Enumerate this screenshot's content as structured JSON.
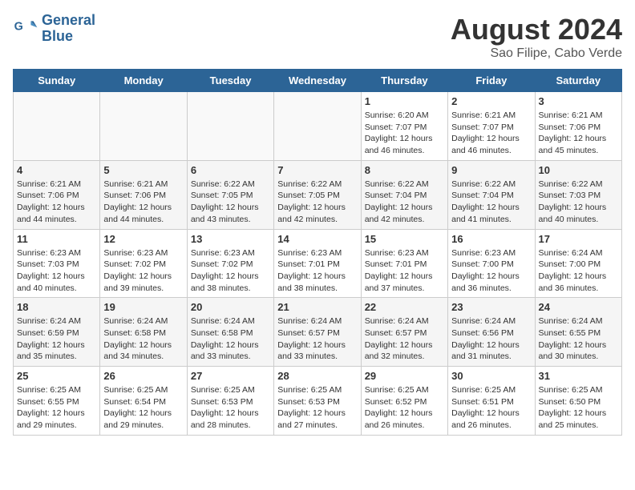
{
  "header": {
    "logo_line1": "General",
    "logo_line2": "Blue",
    "month_year": "August 2024",
    "location": "Sao Filipe, Cabo Verde"
  },
  "days_of_week": [
    "Sunday",
    "Monday",
    "Tuesday",
    "Wednesday",
    "Thursday",
    "Friday",
    "Saturday"
  ],
  "weeks": [
    [
      {
        "day": "",
        "info": ""
      },
      {
        "day": "",
        "info": ""
      },
      {
        "day": "",
        "info": ""
      },
      {
        "day": "",
        "info": ""
      },
      {
        "day": "1",
        "info": "Sunrise: 6:20 AM\nSunset: 7:07 PM\nDaylight: 12 hours\nand 46 minutes."
      },
      {
        "day": "2",
        "info": "Sunrise: 6:21 AM\nSunset: 7:07 PM\nDaylight: 12 hours\nand 46 minutes."
      },
      {
        "day": "3",
        "info": "Sunrise: 6:21 AM\nSunset: 7:06 PM\nDaylight: 12 hours\nand 45 minutes."
      }
    ],
    [
      {
        "day": "4",
        "info": "Sunrise: 6:21 AM\nSunset: 7:06 PM\nDaylight: 12 hours\nand 44 minutes."
      },
      {
        "day": "5",
        "info": "Sunrise: 6:21 AM\nSunset: 7:06 PM\nDaylight: 12 hours\nand 44 minutes."
      },
      {
        "day": "6",
        "info": "Sunrise: 6:22 AM\nSunset: 7:05 PM\nDaylight: 12 hours\nand 43 minutes."
      },
      {
        "day": "7",
        "info": "Sunrise: 6:22 AM\nSunset: 7:05 PM\nDaylight: 12 hours\nand 42 minutes."
      },
      {
        "day": "8",
        "info": "Sunrise: 6:22 AM\nSunset: 7:04 PM\nDaylight: 12 hours\nand 42 minutes."
      },
      {
        "day": "9",
        "info": "Sunrise: 6:22 AM\nSunset: 7:04 PM\nDaylight: 12 hours\nand 41 minutes."
      },
      {
        "day": "10",
        "info": "Sunrise: 6:22 AM\nSunset: 7:03 PM\nDaylight: 12 hours\nand 40 minutes."
      }
    ],
    [
      {
        "day": "11",
        "info": "Sunrise: 6:23 AM\nSunset: 7:03 PM\nDaylight: 12 hours\nand 40 minutes."
      },
      {
        "day": "12",
        "info": "Sunrise: 6:23 AM\nSunset: 7:02 PM\nDaylight: 12 hours\nand 39 minutes."
      },
      {
        "day": "13",
        "info": "Sunrise: 6:23 AM\nSunset: 7:02 PM\nDaylight: 12 hours\nand 38 minutes."
      },
      {
        "day": "14",
        "info": "Sunrise: 6:23 AM\nSunset: 7:01 PM\nDaylight: 12 hours\nand 38 minutes."
      },
      {
        "day": "15",
        "info": "Sunrise: 6:23 AM\nSunset: 7:01 PM\nDaylight: 12 hours\nand 37 minutes."
      },
      {
        "day": "16",
        "info": "Sunrise: 6:23 AM\nSunset: 7:00 PM\nDaylight: 12 hours\nand 36 minutes."
      },
      {
        "day": "17",
        "info": "Sunrise: 6:24 AM\nSunset: 7:00 PM\nDaylight: 12 hours\nand 36 minutes."
      }
    ],
    [
      {
        "day": "18",
        "info": "Sunrise: 6:24 AM\nSunset: 6:59 PM\nDaylight: 12 hours\nand 35 minutes."
      },
      {
        "day": "19",
        "info": "Sunrise: 6:24 AM\nSunset: 6:58 PM\nDaylight: 12 hours\nand 34 minutes."
      },
      {
        "day": "20",
        "info": "Sunrise: 6:24 AM\nSunset: 6:58 PM\nDaylight: 12 hours\nand 33 minutes."
      },
      {
        "day": "21",
        "info": "Sunrise: 6:24 AM\nSunset: 6:57 PM\nDaylight: 12 hours\nand 33 minutes."
      },
      {
        "day": "22",
        "info": "Sunrise: 6:24 AM\nSunset: 6:57 PM\nDaylight: 12 hours\nand 32 minutes."
      },
      {
        "day": "23",
        "info": "Sunrise: 6:24 AM\nSunset: 6:56 PM\nDaylight: 12 hours\nand 31 minutes."
      },
      {
        "day": "24",
        "info": "Sunrise: 6:24 AM\nSunset: 6:55 PM\nDaylight: 12 hours\nand 30 minutes."
      }
    ],
    [
      {
        "day": "25",
        "info": "Sunrise: 6:25 AM\nSunset: 6:55 PM\nDaylight: 12 hours\nand 29 minutes."
      },
      {
        "day": "26",
        "info": "Sunrise: 6:25 AM\nSunset: 6:54 PM\nDaylight: 12 hours\nand 29 minutes."
      },
      {
        "day": "27",
        "info": "Sunrise: 6:25 AM\nSunset: 6:53 PM\nDaylight: 12 hours\nand 28 minutes."
      },
      {
        "day": "28",
        "info": "Sunrise: 6:25 AM\nSunset: 6:53 PM\nDaylight: 12 hours\nand 27 minutes."
      },
      {
        "day": "29",
        "info": "Sunrise: 6:25 AM\nSunset: 6:52 PM\nDaylight: 12 hours\nand 26 minutes."
      },
      {
        "day": "30",
        "info": "Sunrise: 6:25 AM\nSunset: 6:51 PM\nDaylight: 12 hours\nand 26 minutes."
      },
      {
        "day": "31",
        "info": "Sunrise: 6:25 AM\nSunset: 6:50 PM\nDaylight: 12 hours\nand 25 minutes."
      }
    ]
  ]
}
